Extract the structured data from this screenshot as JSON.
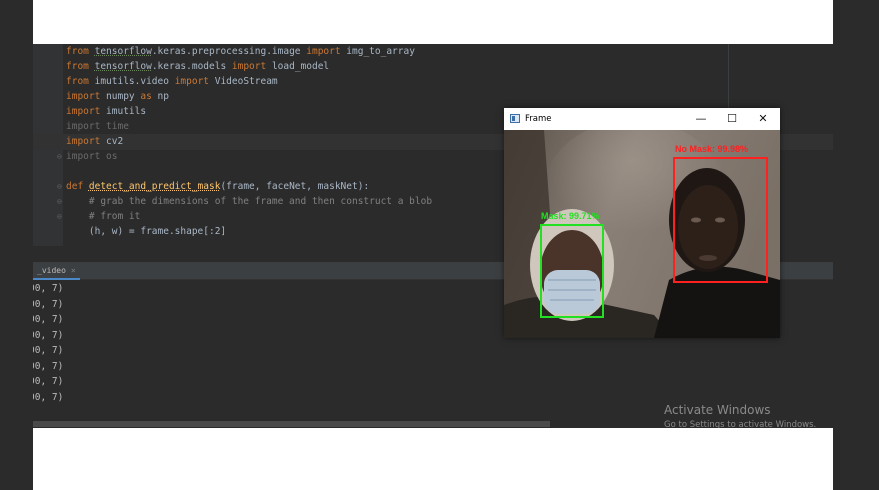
{
  "editor": {
    "lines": [
      [
        {
          "t": "from ",
          "c": "kw"
        },
        {
          "t": "tensorflow",
          "c": "mod"
        },
        {
          "t": ".keras.preprocessing.image ",
          "c": ""
        },
        {
          "t": "import ",
          "c": "kw"
        },
        {
          "t": "img_to_array",
          "c": ""
        }
      ],
      [
        {
          "t": "from ",
          "c": "kw"
        },
        {
          "t": "tensorflow",
          "c": "mod"
        },
        {
          "t": ".keras.models ",
          "c": ""
        },
        {
          "t": "import ",
          "c": "kw"
        },
        {
          "t": "load_model",
          "c": ""
        }
      ],
      [
        {
          "t": "from ",
          "c": "kw"
        },
        {
          "t": "imutils.video ",
          "c": ""
        },
        {
          "t": "import ",
          "c": "kw"
        },
        {
          "t": "VideoStream",
          "c": ""
        }
      ],
      [
        {
          "t": "import ",
          "c": "kw"
        },
        {
          "t": "numpy ",
          "c": ""
        },
        {
          "t": "as ",
          "c": "kw"
        },
        {
          "t": "np",
          "c": ""
        }
      ],
      [
        {
          "t": "import ",
          "c": "kw"
        },
        {
          "t": "imutils",
          "c": ""
        }
      ],
      [
        {
          "t": "import time",
          "c": "dim"
        }
      ],
      [
        {
          "t": "import ",
          "c": "kw"
        },
        {
          "t": "cv2",
          "c": ""
        }
      ],
      [
        {
          "t": "import os",
          "c": "dim"
        }
      ],
      [
        {
          "t": "",
          "c": ""
        }
      ],
      [
        {
          "t": "def ",
          "c": "kw"
        },
        {
          "t": "detect_and_predict_mask",
          "c": "fn"
        },
        {
          "t": "(frame, faceNet, maskNet):",
          "c": ""
        }
      ],
      [
        {
          "t": "    # grab the dimensions of the frame and then construct a blob",
          "c": "cm"
        }
      ],
      [
        {
          "t": "    # from it",
          "c": "cm"
        }
      ],
      [
        {
          "t": "    (h, w) = frame.shape[:2]",
          "c": ""
        }
      ],
      [
        {
          "t": "    ",
          "c": ""
        },
        {
          "t": "(h, w) = frame.shape[:2]",
          "c": ""
        }
      ]
    ]
  },
  "run_panel": {
    "tab_label": "_video",
    "close_icon": "×",
    "output_lines": [
      "00, 7)",
      "00, 7)",
      "00, 7)",
      "00, 7)",
      "00, 7)",
      "00, 7)",
      "00, 7)",
      "00, 7)"
    ]
  },
  "frame_window": {
    "title": "Frame",
    "minimize": "—",
    "maximize": "☐",
    "close": "✕",
    "detections": [
      {
        "label": "No Mask: 99.98%",
        "color": "#ff2020"
      },
      {
        "label": "Mask: 99.71%",
        "color": "#22e022"
      }
    ]
  },
  "watermark": {
    "title": "Activate Windows",
    "subtitle": "Go to Settings to activate Windows."
  },
  "colors": {
    "ide_background": "#2b2b2b",
    "keyword": "#cc7832",
    "function": "#ffc66d",
    "comment": "#808080",
    "no_mask_box": "#ff2020",
    "mask_box": "#22e022"
  }
}
